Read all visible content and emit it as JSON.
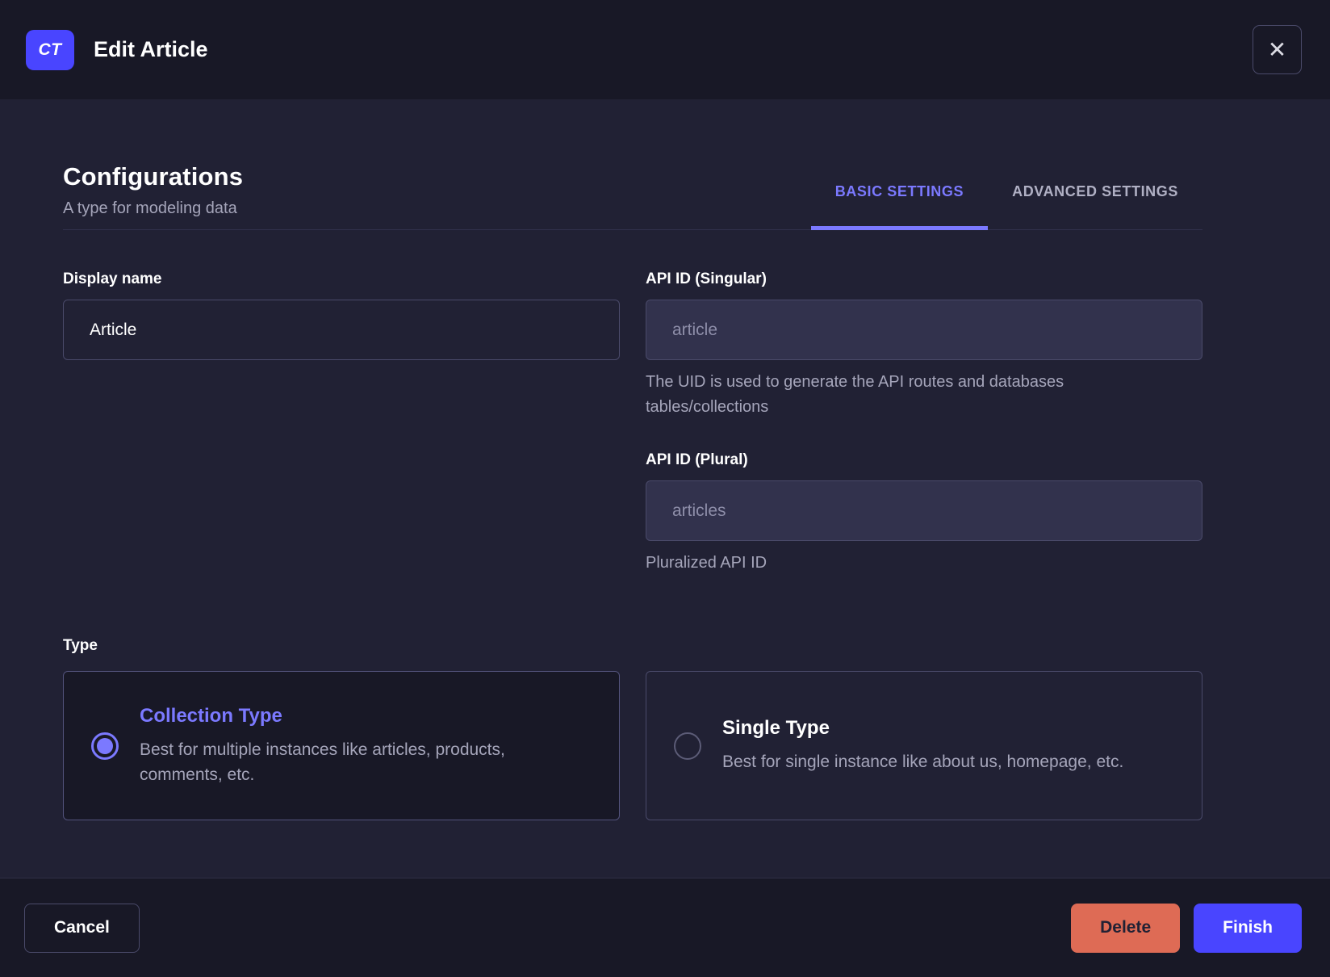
{
  "colors": {
    "primary": "#4945FF",
    "primary_light": "#7B79FF",
    "danger": "#DE6B55",
    "chrome_bg": "#181826",
    "body_bg": "#212134",
    "border": "#4A4A6A"
  },
  "header": {
    "badge": "CT",
    "title": "Edit Article",
    "close_icon": "✕"
  },
  "main": {
    "title": "Configurations",
    "subtitle": "A type for modeling data",
    "tabs": [
      {
        "label": "BASIC SETTINGS",
        "active": true
      },
      {
        "label": "ADVANCED SETTINGS",
        "active": false
      }
    ],
    "fields": {
      "display_name": {
        "label": "Display name",
        "value": "Article"
      },
      "api_id_singular": {
        "label": "API ID (Singular)",
        "value": "article",
        "hint": "The UID is used to generate the API routes and databases tables/collections"
      },
      "api_id_plural": {
        "label": "API ID (Plural)",
        "value": "articles",
        "hint": "Pluralized API ID"
      }
    },
    "type_section": {
      "label": "Type",
      "options": [
        {
          "title": "Collection Type",
          "description": "Best for multiple instances like articles, products, comments, etc.",
          "selected": true
        },
        {
          "title": "Single Type",
          "description": "Best for single instance like about us, homepage, etc.",
          "selected": false
        }
      ]
    }
  },
  "footer": {
    "cancel_label": "Cancel",
    "delete_label": "Delete",
    "finish_label": "Finish"
  }
}
